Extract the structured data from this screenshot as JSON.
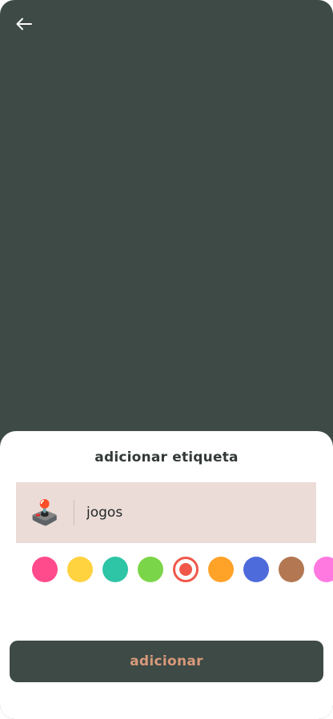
{
  "header": {
    "back_icon": "arrow-left-icon"
  },
  "sheet": {
    "title": "adicionar etiqueta",
    "tag": {
      "emoji": "🕹️",
      "name": "jogos",
      "background": "#ecdcd8"
    },
    "colors": [
      {
        "hex": "#ff4a8b",
        "selected": false
      },
      {
        "hex": "#ffd23f",
        "selected": false
      },
      {
        "hex": "#2ec4a6",
        "selected": false
      },
      {
        "hex": "#7bd548",
        "selected": false
      },
      {
        "hex": "#f0574a",
        "selected": true
      },
      {
        "hex": "#ffa228",
        "selected": false
      },
      {
        "hex": "#4e6bdb",
        "selected": false
      },
      {
        "hex": "#b37752",
        "selected": false
      },
      {
        "hex": "#ff79e0",
        "selected": false
      }
    ],
    "submit_label": "adicionar"
  },
  "theme": {
    "primary": "#3d4a46",
    "accent_text": "#d8997a"
  }
}
